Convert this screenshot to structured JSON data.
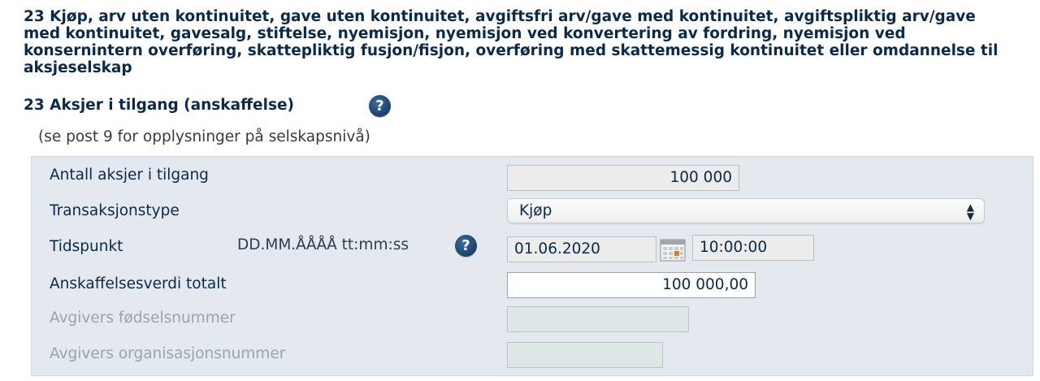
{
  "section": {
    "heading": "23 Kjøp, arv uten kontinuitet, gave uten kontinuitet, avgiftsfri arv/gave med kontinuitet, avgiftspliktig arv/gave med kontinuitet, gavesalg, stiftelse, nyemisjon, nyemisjon ved konvertering av fordring, nyemisjon ved konsernintern overføring, skattepliktig fusjon/fisjon, overføring med skattemessig kontinuitet eller omdannelse til aksjeselskap",
    "subheading": "23 Aksjer i tilgang (anskaffelse)",
    "help_glyph": "?",
    "note": "(se post 9 for opplysninger på selskapsnivå)"
  },
  "form": {
    "antall": {
      "label": "Antall aksjer i tilgang",
      "value": "100 000"
    },
    "transaksjonstype": {
      "label": "Transaksjonstype",
      "value": "Kjøp",
      "arrows": "▲▼"
    },
    "tidspunkt": {
      "label": "Tidspunkt",
      "hint": "DD.MM.ÅÅÅÅ tt:mm:ss",
      "date": "01.06.2020",
      "time": "10:00:00",
      "help_glyph": "?"
    },
    "anskaffelsesverdi": {
      "label": "Anskaffelsesverdi totalt",
      "value": "100 000,00"
    },
    "fodselsnummer": {
      "label": "Avgivers fødselsnummer",
      "value": ""
    },
    "orgnummer": {
      "label": "Avgivers organisasjonsnummer",
      "value": ""
    }
  },
  "colors": {
    "heading": "#0b2a4a",
    "panel_bg": "#e4e9f0",
    "help_icon": "#1f4672",
    "disabled_text": "#9aa3ad"
  },
  "icons": {
    "help": "question-circle-icon",
    "calendar": "calendar-icon",
    "select_arrows": "updown-chevron-icon"
  }
}
